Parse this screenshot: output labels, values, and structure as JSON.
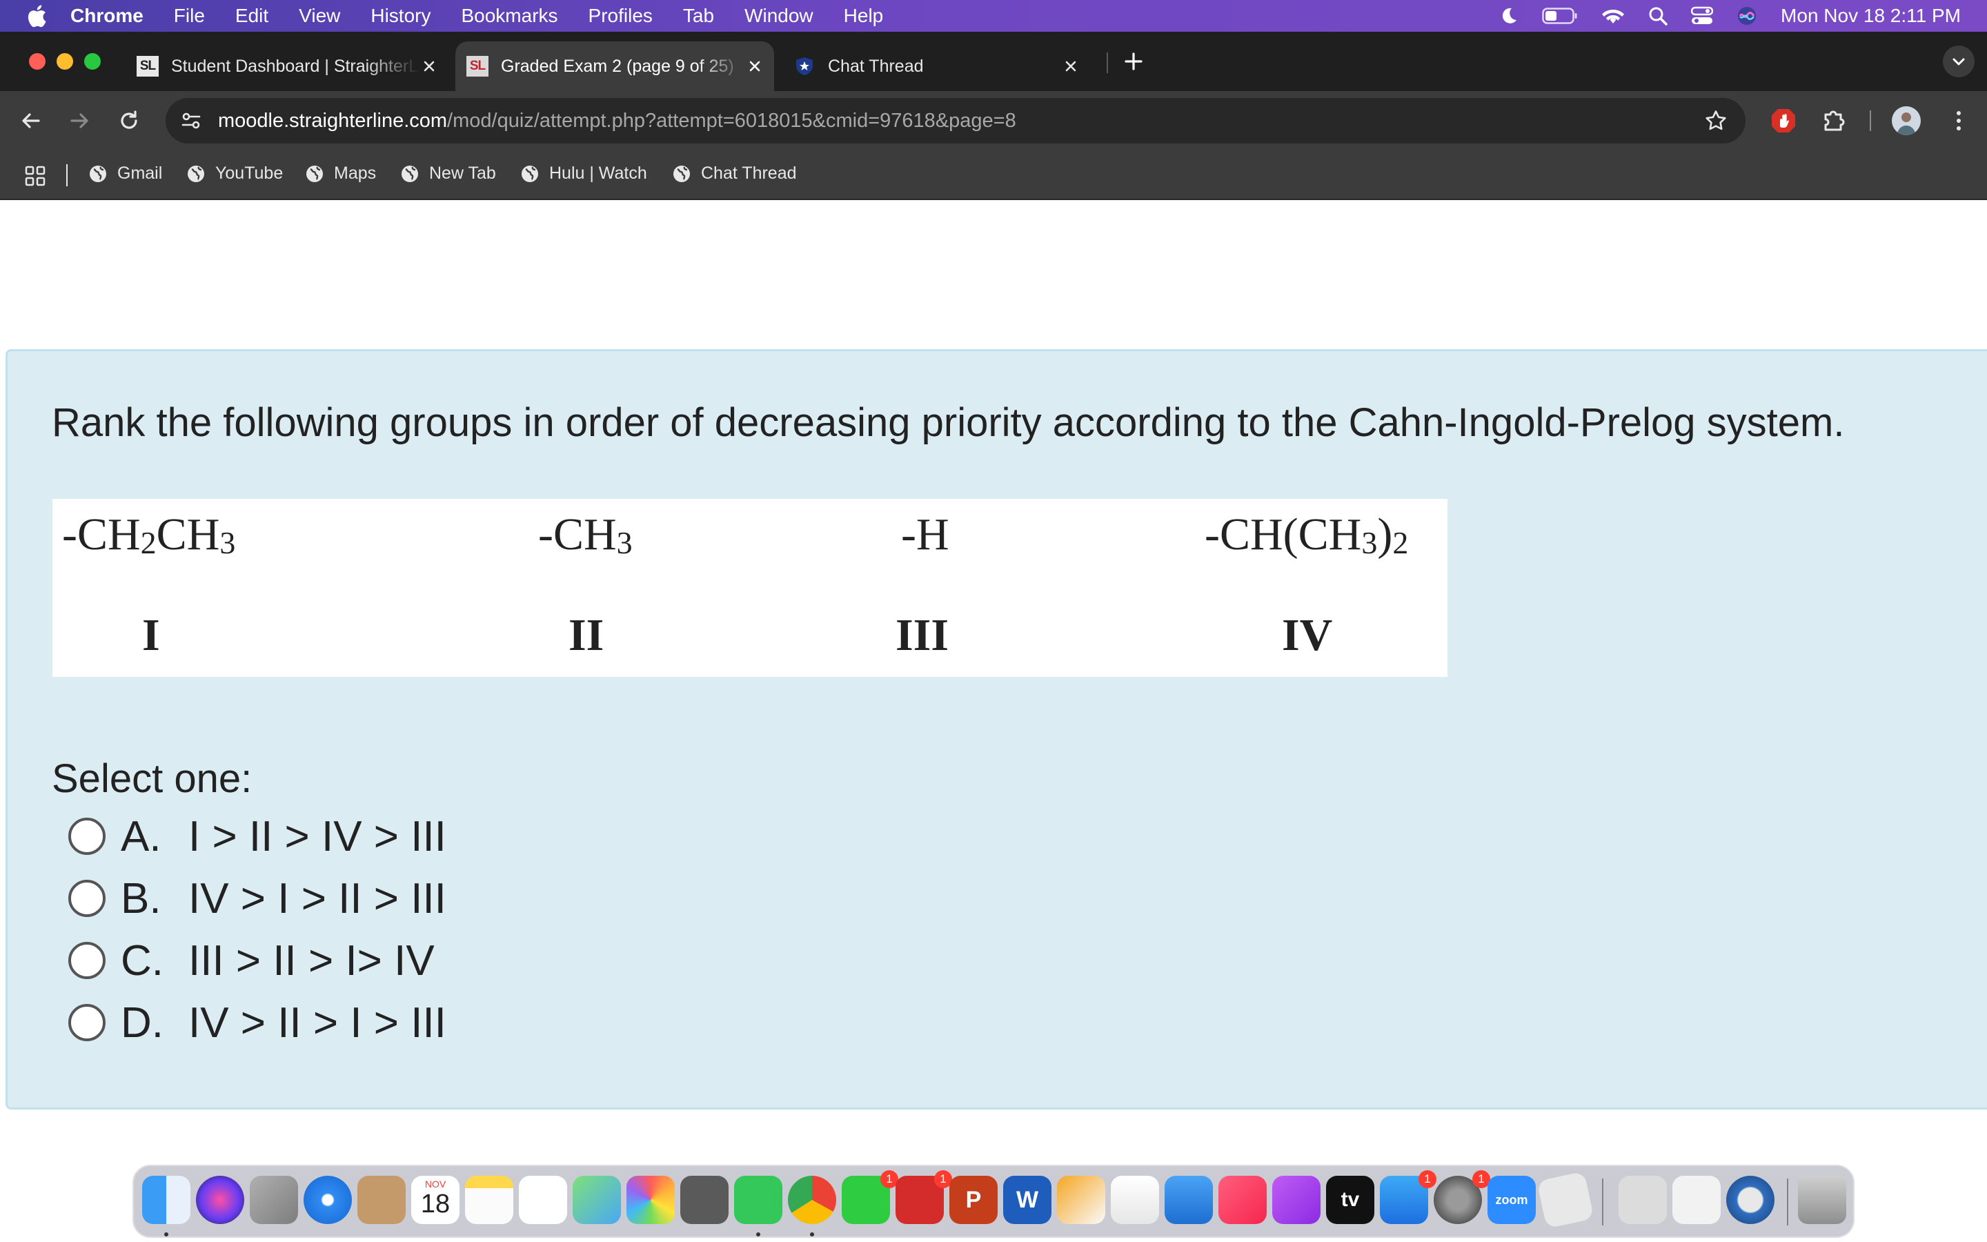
{
  "menubar": {
    "app_name": "Chrome",
    "menus": [
      "File",
      "Edit",
      "View",
      "History",
      "Bookmarks",
      "Profiles",
      "Tab",
      "Window",
      "Help"
    ],
    "clock": "Mon Nov 18  2:11 PM"
  },
  "tabs": [
    {
      "title": "Student Dashboard | StraighterLine",
      "favicon": "straighterline-logo",
      "favicon_text": "SL",
      "active": false
    },
    {
      "title": "Graded Exam 2 (page 9 of 25)",
      "favicon": "straighterline-logo",
      "favicon_text": "SL",
      "active": true
    },
    {
      "title": "Chat Thread",
      "favicon": "star-shield-icon",
      "active": false
    }
  ],
  "address_bar": {
    "host": "moodle.straighterline.com",
    "path": "/mod/quiz/attempt.php?attempt=6018015&cmid=97618&page=8"
  },
  "bookmarks": [
    "Gmail",
    "YouTube",
    "Maps",
    "New Tab",
    "Hulu | Watch",
    "Chat Thread"
  ],
  "question": {
    "text": "Rank the following groups in order of decreasing priority according to the Cahn-Ingold-Prelog system.",
    "groups": [
      {
        "formula": "-CH2CH3",
        "numeral": "I"
      },
      {
        "formula": "-CH3",
        "numeral": "II"
      },
      {
        "formula": "-H",
        "numeral": "III"
      },
      {
        "formula": "-CH(CH3)2",
        "numeral": "IV"
      }
    ],
    "prompt": "Select one:",
    "options": [
      {
        "letter": "A.",
        "text": "I > II > IV > III"
      },
      {
        "letter": "B.",
        "text": "IV > I > II > III"
      },
      {
        "letter": "C.",
        "text": "III > II > I> IV"
      },
      {
        "letter": "D.",
        "text": "IV > II > I > III"
      }
    ]
  },
  "dock": {
    "calendar_month": "NOV",
    "calendar_day": "18",
    "facetime_badge": "1",
    "photo_booth_badge": "1",
    "app_store_badge": "1",
    "settings_badge": "1",
    "word_letter": "W",
    "powerpoint_letter": "P",
    "tv_label": "tv",
    "zoom_label": "zoom"
  },
  "colors": {
    "menubar_gradient_start": "#4a3ea8",
    "menubar_gradient_end": "#7b4bc6",
    "question_background": "#dcecf3",
    "question_border": "#c0e1ed",
    "chrome_dark": "#1f1f1f"
  }
}
